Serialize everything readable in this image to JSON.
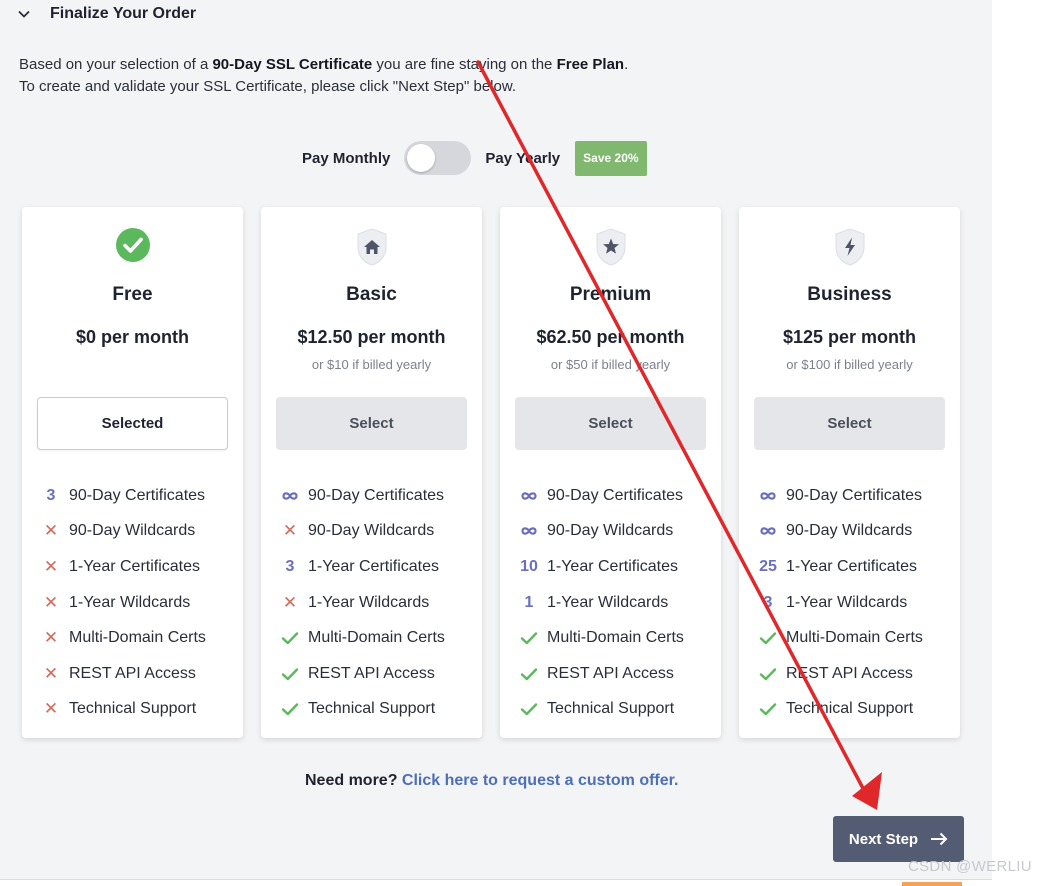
{
  "header": {
    "title": "Finalize Your Order"
  },
  "intro": {
    "p1_a": "Based on your selection of a ",
    "p1_b": "90-Day SSL Certificate",
    "p1_c": " you are fine staying on the ",
    "p1_d": "Free Plan",
    "p1_e": ".",
    "p2": "To create and validate your SSL Certificate, please click \"Next Step\" below."
  },
  "billing": {
    "monthly_label": "Pay Monthly",
    "yearly_label": "Pay Yearly",
    "save_badge": "Save 20%",
    "yearly_on": false
  },
  "plans": [
    {
      "name": "Free",
      "price": "$0 per month",
      "sub": "",
      "button": "Selected",
      "selected": true,
      "icon": "check-circle-icon",
      "features": [
        {
          "mark": "3",
          "label": "90-Day Certificates"
        },
        {
          "mark": "x",
          "label": "90-Day Wildcards"
        },
        {
          "mark": "x",
          "label": "1-Year Certificates"
        },
        {
          "mark": "x",
          "label": "1-Year Wildcards"
        },
        {
          "mark": "x",
          "label": "Multi-Domain Certs"
        },
        {
          "mark": "x",
          "label": "REST API Access"
        },
        {
          "mark": "x",
          "label": "Technical Support"
        }
      ]
    },
    {
      "name": "Basic",
      "price": "$12.50 per month",
      "sub": "or $10 if billed yearly",
      "button": "Select",
      "selected": false,
      "icon": "home-shield-icon",
      "features": [
        {
          "mark": "inf",
          "label": "90-Day Certificates"
        },
        {
          "mark": "x",
          "label": "90-Day Wildcards"
        },
        {
          "mark": "3",
          "label": "1-Year Certificates"
        },
        {
          "mark": "x",
          "label": "1-Year Wildcards"
        },
        {
          "mark": "check",
          "label": "Multi-Domain Certs"
        },
        {
          "mark": "check",
          "label": "REST API Access"
        },
        {
          "mark": "check",
          "label": "Technical Support"
        }
      ]
    },
    {
      "name": "Premium",
      "price": "$62.50 per month",
      "sub": "or $50 if billed yearly",
      "button": "Select",
      "selected": false,
      "icon": "star-shield-icon",
      "features": [
        {
          "mark": "inf",
          "label": "90-Day Certificates"
        },
        {
          "mark": "inf",
          "label": "90-Day Wildcards"
        },
        {
          "mark": "10",
          "label": "1-Year Certificates"
        },
        {
          "mark": "1",
          "label": "1-Year Wildcards"
        },
        {
          "mark": "check",
          "label": "Multi-Domain Certs"
        },
        {
          "mark": "check",
          "label": "REST API Access"
        },
        {
          "mark": "check",
          "label": "Technical Support"
        }
      ]
    },
    {
      "name": "Business",
      "price": "$125 per month",
      "sub": "or $100 if billed yearly",
      "button": "Select",
      "selected": false,
      "icon": "bolt-shield-icon",
      "features": [
        {
          "mark": "inf",
          "label": "90-Day Certificates"
        },
        {
          "mark": "inf",
          "label": "90-Day Wildcards"
        },
        {
          "mark": "25",
          "label": "1-Year Certificates"
        },
        {
          "mark": "3",
          "label": "1-Year Wildcards"
        },
        {
          "mark": "check",
          "label": "Multi-Domain Certs"
        },
        {
          "mark": "check",
          "label": "REST API Access"
        },
        {
          "mark": "check",
          "label": "Technical Support"
        }
      ]
    }
  ],
  "need_more": {
    "question": "Need more?",
    "link": "Click here to request a custom offer."
  },
  "next_button": {
    "label": "Next Step"
  },
  "watermark": "CSDN @WERLIU",
  "colors": {
    "accent": "#535c73",
    "check": "#5cb85c",
    "cross": "#d26a5c",
    "count": "#6b6fbd",
    "annotation": "#e0282b",
    "badge": "#7fb86e"
  }
}
